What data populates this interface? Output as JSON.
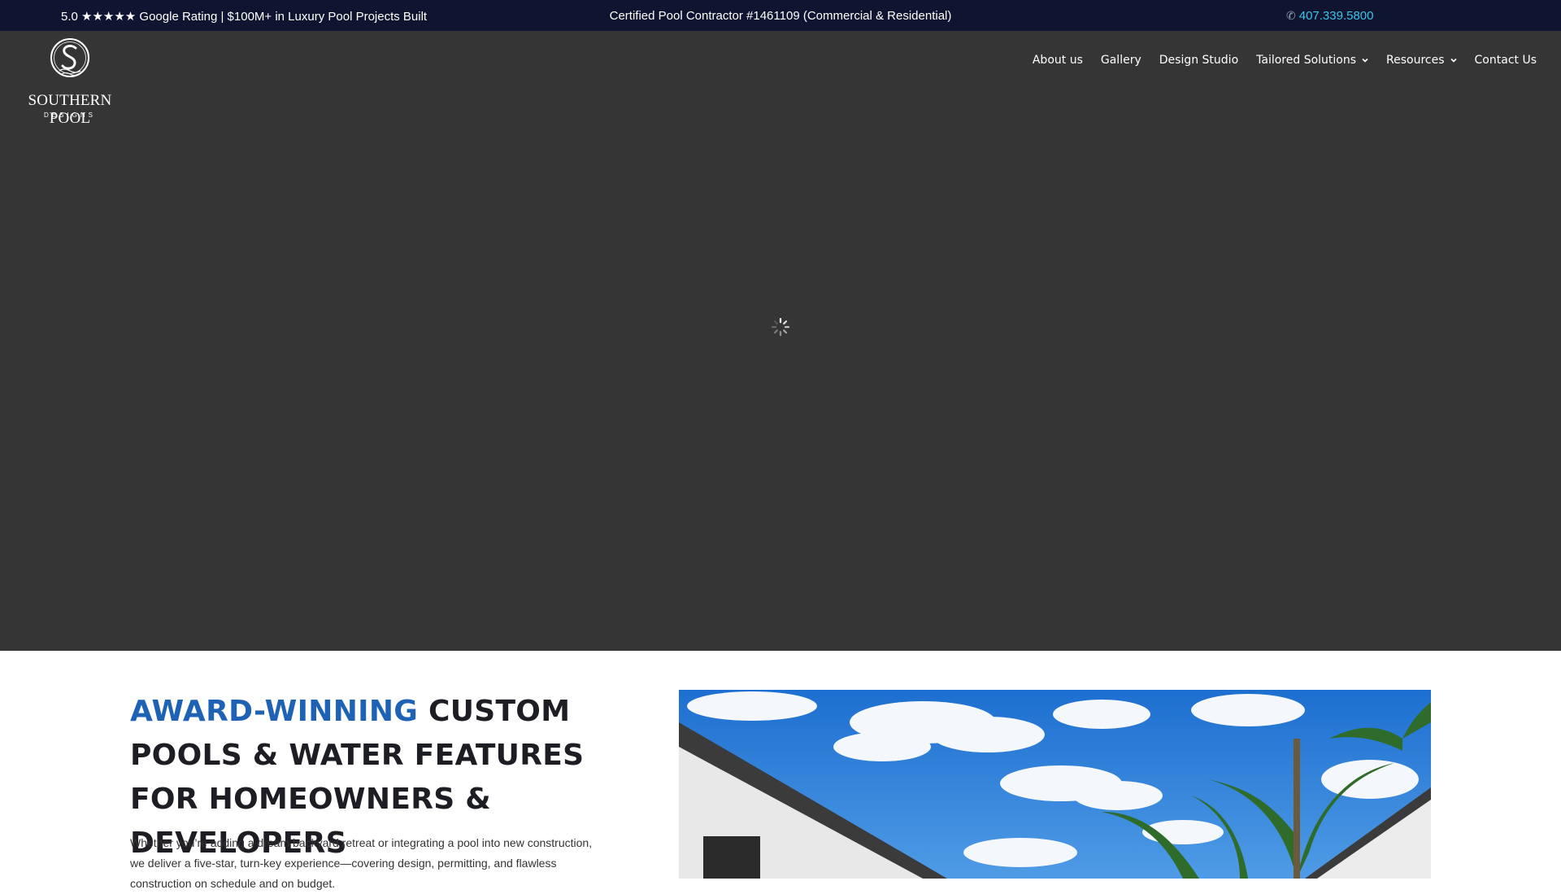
{
  "topbar": {
    "left_text": "5.0 ★★★★★ Google Rating | $100M+ in Luxury Pool Projects Built",
    "center_text": "Certified Pool Contractor #1461109 (Commercial & Residential)",
    "phone_icon": "phone-icon",
    "phone": "407.339.5800"
  },
  "logo": {
    "monogram": "S",
    "name": "SOUTHERN POOL",
    "subtitle": "DESIGNS"
  },
  "nav": {
    "items": [
      {
        "label": "About us"
      },
      {
        "label": "Gallery"
      },
      {
        "label": "Design Studio"
      },
      {
        "label": "Tailored Solutions",
        "dropdown": true
      },
      {
        "label": "Resources",
        "dropdown": true
      },
      {
        "label": "Contact Us"
      }
    ]
  },
  "hero": {
    "loading_icon": "loading-spinner-icon"
  },
  "intro": {
    "title_accent": "AWARD-WINNING",
    "title_rest": " CUSTOM POOLS & WATER FEATURES FOR HOMEOWNERS & DEVELOPERS",
    "body": "Whether you’re adding a dream backyard retreat or integrating a pool into new construction, we deliver a five-star, turn-key experience—covering design, permitting, and flawless construction on schedule and on budget."
  },
  "colors": {
    "topbar_bg": "#0f1530",
    "hero_bg": "#353535",
    "accent_blue": "#1d62b4",
    "phone_link": "#3bc4e8"
  }
}
